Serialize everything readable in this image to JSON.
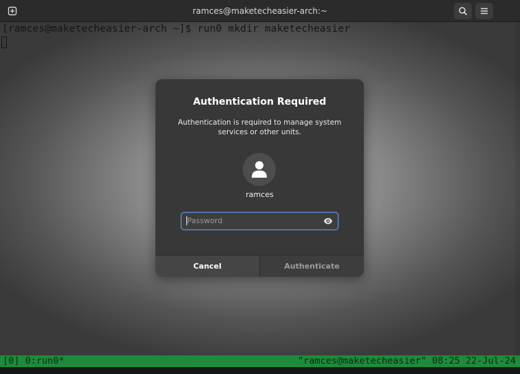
{
  "window": {
    "title": "ramces@maketecheasier-arch:~"
  },
  "terminal": {
    "command_line": "[ramces@maketecheasier-arch ~]$ run0 mkdir maketecheasier"
  },
  "statusbar": {
    "left_text": "[0] 0:run0*",
    "right_text": "\"ramces@maketecheasier\" 08:25 22-Jul-24"
  },
  "dialog": {
    "title": "Authentication Required",
    "description": "Authentication is required to manage system services or other units.",
    "avatar_icon": "user-icon",
    "username": "ramces",
    "password": {
      "value": "",
      "placeholder": "Password",
      "reveal_icon": "eye-icon"
    },
    "cancel_label": "Cancel",
    "authenticate_label": "Authenticate"
  },
  "colors": {
    "focus_ring": "#5a8fd8",
    "statusbar_green": "#1f8a3c",
    "dialog_bg": "#383838"
  }
}
